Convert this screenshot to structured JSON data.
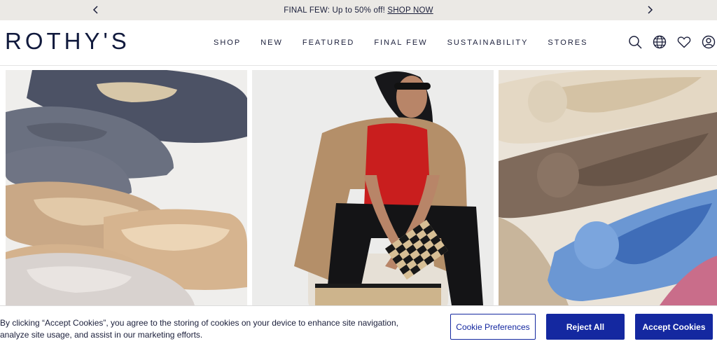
{
  "promo": {
    "text": "FINAL FEW: Up to 50% off! ",
    "link": "SHOP NOW",
    "prev_icon": "chevron-left-icon",
    "next_icon": "chevron-right-icon"
  },
  "header": {
    "logo": "ROTHY'S",
    "nav": [
      "SHOP",
      "NEW",
      "FEATURED",
      "FINAL FEW",
      "SUSTAINABILITY",
      "STORES"
    ],
    "icons": [
      "search-icon",
      "globe-icon",
      "heart-icon",
      "account-icon"
    ]
  },
  "hero": {
    "panels": [
      "knit-flats-image",
      "model-image",
      "knot-flats-image"
    ]
  },
  "cookie": {
    "text": "By clicking “Accept Cookies”, you agree to the storing of cookies on your device to enhance site navigation, analyze site usage, and assist in our marketing efforts.",
    "preferences_label": "Cookie Preferences",
    "reject_label": "Reject All",
    "accept_label": "Accept Cookies"
  },
  "colors": {
    "brand_navy": "#111a3d",
    "button_blue": "#1428a0",
    "promo_bg": "#ebe9e5"
  }
}
